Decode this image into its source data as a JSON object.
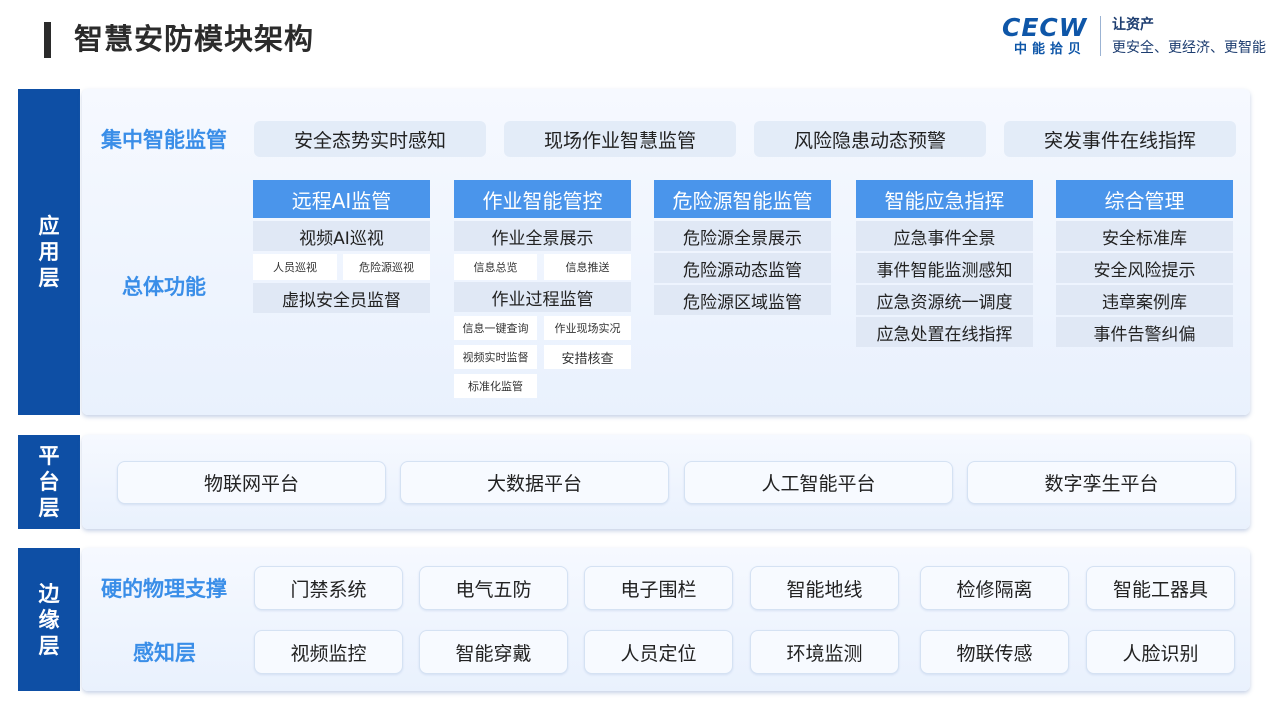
{
  "header": {
    "title": "智慧安防模块架构",
    "logo_text": "CECW",
    "logo_sub": "中能拾贝",
    "slogan_line1": "让资产",
    "slogan_line2": "更安全、更经济、更智能"
  },
  "colors": {
    "brand_blue": "#0e4fa5",
    "accent_blue": "#4a95eb",
    "label_blue": "#3a8ee8"
  },
  "layers": {
    "app": {
      "label": [
        "应",
        "用",
        "层"
      ],
      "central_label": "集中智能监管",
      "central_items": [
        "安全态势实时感知",
        "现场作业智慧监管",
        "风险隐患动态预警",
        "突发事件在线指挥"
      ],
      "overall_label": "总体功能",
      "columns": [
        {
          "title": "远程AI监管",
          "items": [
            "视频AI巡视",
            "人员巡视",
            "危险源巡视",
            "虚拟安全员监督"
          ]
        },
        {
          "title": "作业智能管控",
          "items": [
            "作业全景展示",
            "信息总览",
            "信息推送",
            "作业过程监管",
            "信息一键查询",
            "作业现场实况",
            "视频实时监督",
            "安措核查",
            "标准化监管"
          ]
        },
        {
          "title": "危险源智能监管",
          "items": [
            "危险源全景展示",
            "危险源动态监管",
            "危险源区域监管"
          ]
        },
        {
          "title": "智能应急指挥",
          "items": [
            "应急事件全景",
            "事件智能监测感知",
            "应急资源统一调度",
            "应急处置在线指挥"
          ]
        },
        {
          "title": "综合管理",
          "items": [
            "安全标准库",
            "安全风险提示",
            "违章案例库",
            "事件告警纠偏"
          ]
        }
      ]
    },
    "platform": {
      "label": [
        "平",
        "台",
        "层"
      ],
      "items": [
        "物联网平台",
        "大数据平台",
        "人工智能平台",
        "数字孪生平台"
      ]
    },
    "edge": {
      "label": [
        "边",
        "缘",
        "层"
      ],
      "physical_label": "硬的物理支撑",
      "physical_items": [
        "门禁系统",
        "电气五防",
        "电子围栏",
        "智能地线",
        "检修隔离",
        "智能工器具"
      ],
      "perception_label": "感知层",
      "perception_items": [
        "视频监控",
        "智能穿戴",
        "人员定位",
        "环境监测",
        "物联传感",
        "人脸识别"
      ]
    }
  }
}
